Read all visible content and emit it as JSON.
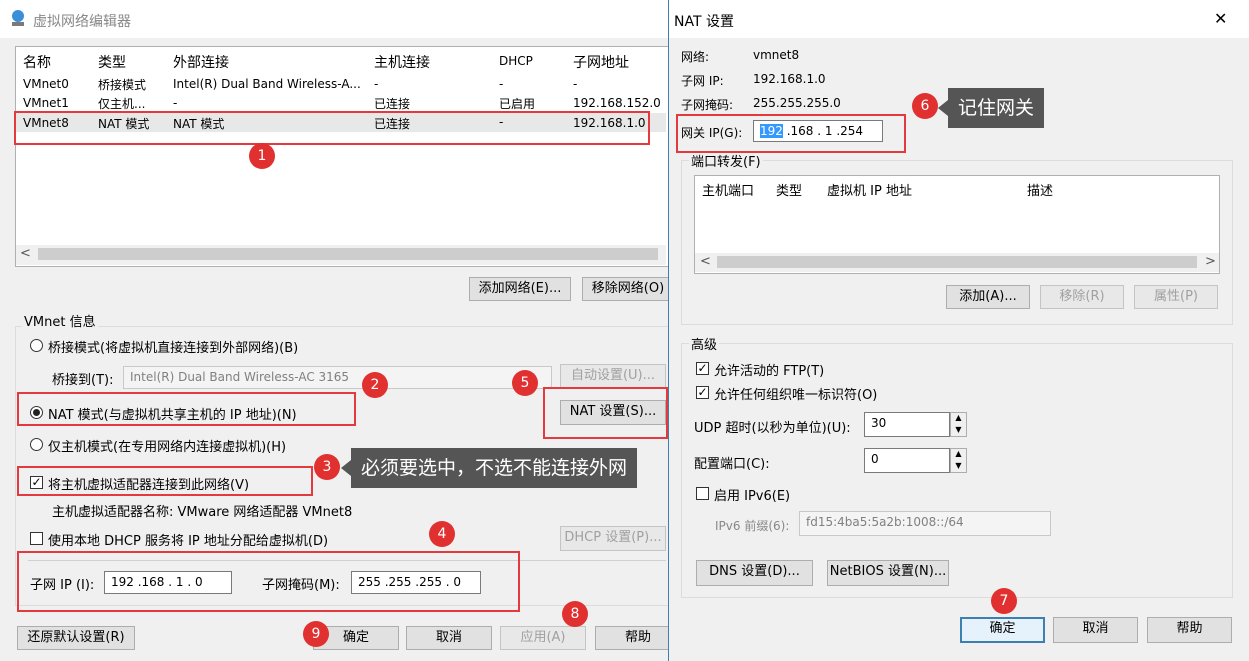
{
  "left_window": {
    "title": "虚拟网络编辑器",
    "columns": [
      "名称",
      "类型",
      "外部连接",
      "主机连接",
      "DHCP",
      "子网地址"
    ],
    "rows": [
      [
        "VMnet0",
        "桥接模式",
        "Intel(R) Dual Band Wireless-A...",
        "-",
        "-",
        "-"
      ],
      [
        "VMnet1",
        "仅主机...",
        "-",
        "已连接",
        "已启用",
        "192.168.152.0"
      ],
      [
        "VMnet8",
        "NAT 模式",
        "NAT 模式",
        "已连接",
        "-",
        "192.168.1.0"
      ]
    ],
    "add_network": "添加网络(E)...",
    "remove_network": "移除网络(O)",
    "vmnet_info": "VMnet 信息",
    "bridge_mode": "桥接模式(将虚拟机直接连接到外部网络)(B)",
    "bridge_to_label": "桥接到(T):",
    "bridge_to_value": "Intel(R) Dual Band Wireless-AC 3165",
    "auto_settings": "自动设置(U)...",
    "nat_mode": "NAT 模式(与虚拟机共享主机的 IP 地址)(N)",
    "nat_settings": "NAT 设置(S)...",
    "host_only_mode": "仅主机模式(在专用网络内连接虚拟机)(H)",
    "connect_host_adapter": "将主机虚拟适配器连接到此网络(V)",
    "host_adapter_name": "主机虚拟适配器名称: VMware 网络适配器 VMnet8",
    "use_local_dhcp": "使用本地 DHCP 服务将 IP 地址分配给虚拟机(D)",
    "dhcp_settings": "DHCP 设置(P)...",
    "subnet_ip_label": "子网 IP (I):",
    "subnet_ip_value": "192 .168 . 1  . 0",
    "subnet_mask_label": "子网掩码(M):",
    "subnet_mask_value": "255 .255 .255 . 0",
    "restore_defaults": "还原默认设置(R)",
    "ok": "确定",
    "cancel": "取消",
    "apply": "应用(A)",
    "help": "帮助"
  },
  "nat_dialog": {
    "title": "NAT 设置",
    "network_label": "网络:",
    "network_value": "vmnet8",
    "subnet_ip_label": "子网 IP:",
    "subnet_ip_value": "192.168.1.0",
    "subnet_mask_label": "子网掩码:",
    "subnet_mask_value": "255.255.255.0",
    "gateway_label": "网关 IP(G):",
    "gateway_sel": "192",
    "gateway_rest": " .168 . 1  .254",
    "port_forwarding": "端口转发(F)",
    "pf_columns": [
      "主机端口",
      "类型",
      "虚拟机 IP 地址",
      "描述"
    ],
    "add": "添加(A)...",
    "remove": "移除(R)",
    "properties": "属性(P)",
    "advanced": "高级",
    "allow_ftp": "允许活动的 FTP(T)",
    "allow_oui": "允许任何组织唯一标识符(O)",
    "udp_timeout_label": "UDP 超时(以秒为单位)(U):",
    "udp_timeout_value": "30",
    "config_port_label": "配置端口(C):",
    "config_port_value": "0",
    "enable_ipv6": "启用 IPv6(E)",
    "ipv6_prefix_label": "IPv6 前缀(6):",
    "ipv6_prefix_value": "fd15:4ba5:5a2b:1008::/64",
    "dns_settings": "DNS 设置(D)...",
    "netbios_settings": "NetBIOS 设置(N)...",
    "ok": "确定",
    "cancel": "取消",
    "help": "帮助",
    "close_glyph": "✕"
  },
  "annotations": {
    "n1": "1",
    "n2": "2",
    "n3": "3",
    "n4": "4",
    "n5": "5",
    "n6": "6",
    "n7": "7",
    "n8": "8",
    "n9": "9",
    "callout3": "必须要选中，不选不能连接外网",
    "callout6": "记住网关"
  },
  "colors": {
    "annotation_red": "#e33a3f",
    "callout_bg": "#555555",
    "selection_blue": "#3399ff"
  }
}
